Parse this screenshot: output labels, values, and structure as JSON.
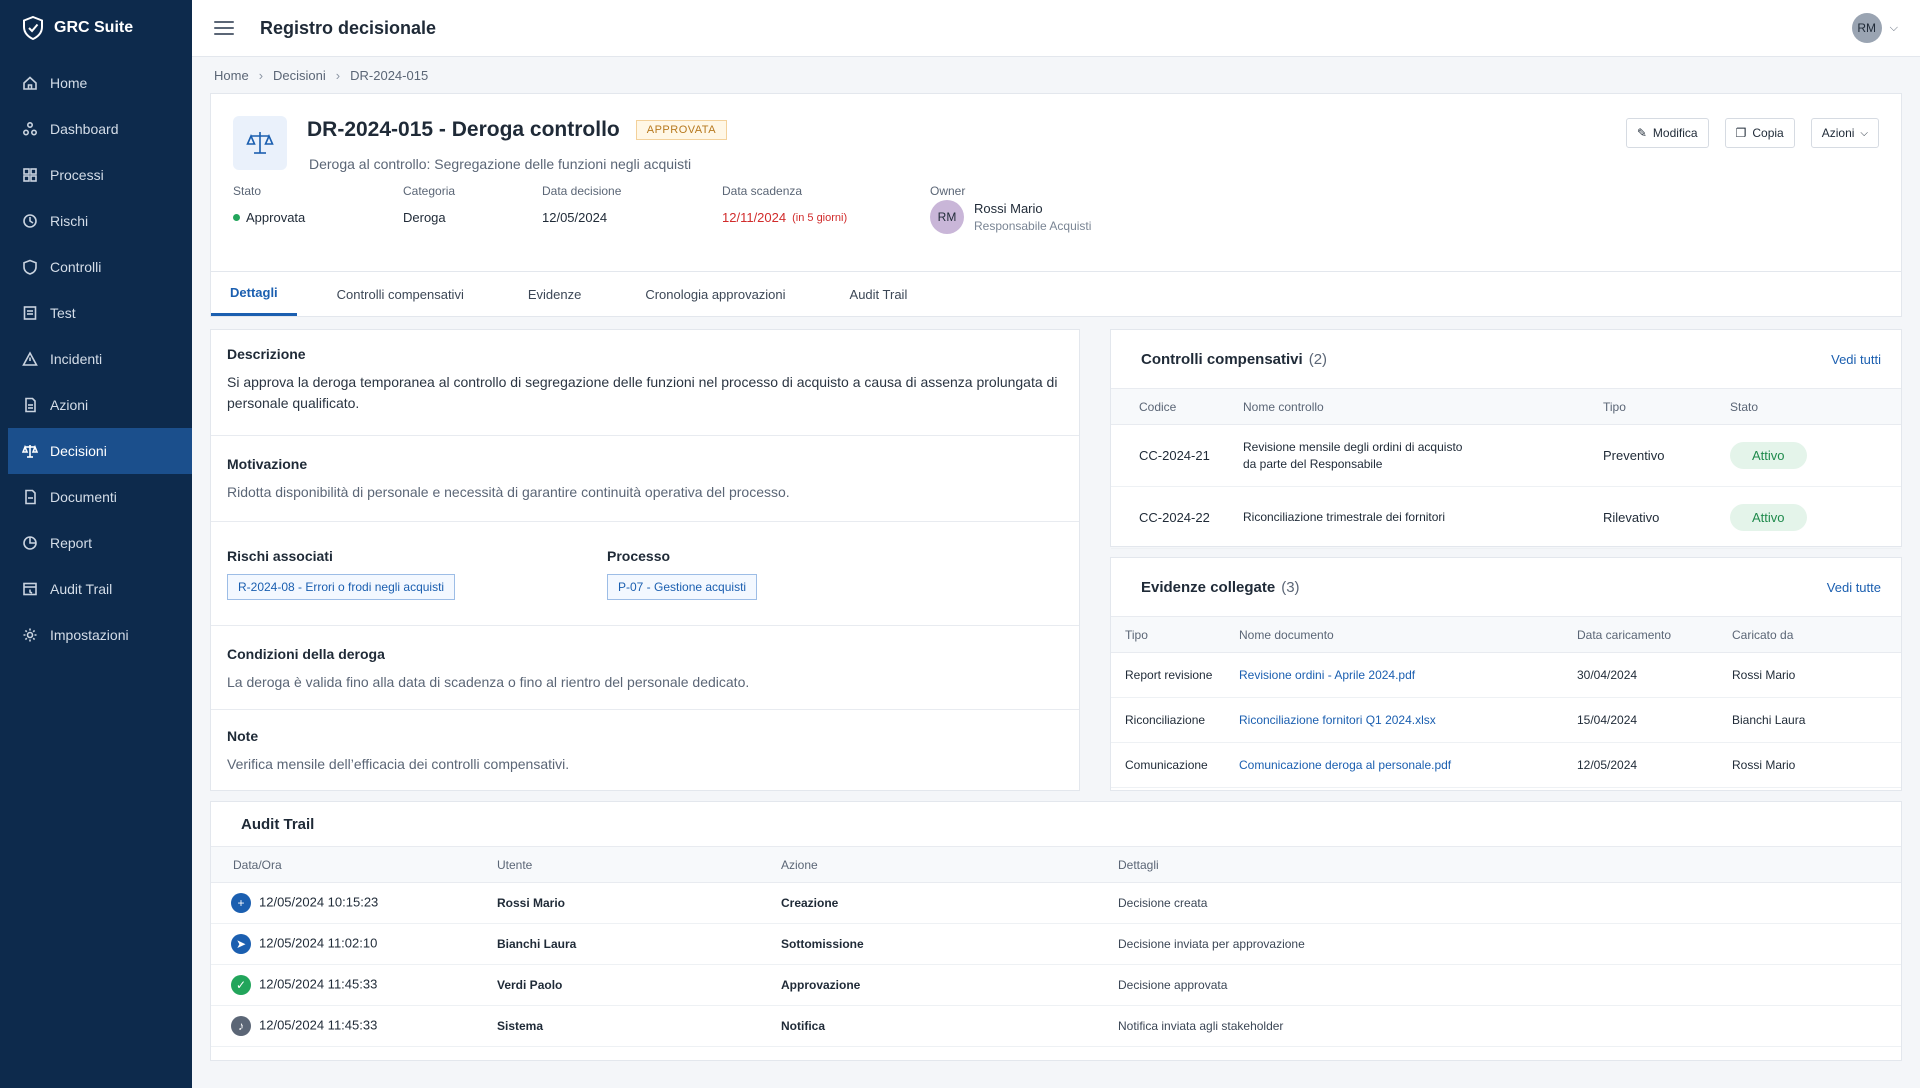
{
  "brand": {
    "name": "GRC Suite"
  },
  "sidebar": {
    "items": [
      {
        "label": "Home",
        "icon": "home-icon"
      },
      {
        "label": "Dashboard",
        "icon": "dashboard-icon"
      },
      {
        "label": "Processi",
        "icon": "process-icon"
      },
      {
        "label": "Rischi",
        "icon": "risk-icon"
      },
      {
        "label": "Controlli",
        "icon": "shield-icon"
      },
      {
        "label": "Test",
        "icon": "test-icon"
      },
      {
        "label": "Incidenti",
        "icon": "warning-icon"
      },
      {
        "label": "Azioni",
        "icon": "actions-icon"
      },
      {
        "label": "Decisioni",
        "icon": "scale-icon",
        "active": true
      },
      {
        "label": "Documenti",
        "icon": "document-icon"
      },
      {
        "label": "Report",
        "icon": "report-icon"
      },
      {
        "label": "Audit Trail",
        "icon": "audit-icon"
      },
      {
        "label": "Impostazioni",
        "icon": "gear-icon"
      }
    ]
  },
  "topbar": {
    "title": "Registro decisionale",
    "user_initials": "RM"
  },
  "breadcrumb": [
    "Home",
    "Decisioni",
    "DR-2024-015"
  ],
  "decision": {
    "title": "DR-2024-015 - Deroga controllo",
    "status_badge": "APPROVATA",
    "subtitle": "Deroga al controllo: Segregazione delle funzioni negli acquisti",
    "actions": {
      "edit": "Modifica",
      "copy": "Copia",
      "more": "Azioni"
    },
    "meta": {
      "stato_label": "Stato",
      "stato": "Approvata",
      "categoria_label": "Categoria",
      "categoria": "Deroga",
      "data_decisione_label": "Data decisione",
      "data_decisione": "12/05/2024",
      "data_scadenza_label": "Data scadenza",
      "data_scadenza": "12/11/2024",
      "scadenza_note": "(in 5 giorni)",
      "owner_label": "Owner",
      "owner_initials": "RM",
      "owner_name": "Rossi Mario",
      "owner_role": "Responsabile Acquisti"
    }
  },
  "tabs": [
    "Dettagli",
    "Controlli compensativi",
    "Evidenze",
    "Cronologia approvazioni",
    "Audit Trail"
  ],
  "details": {
    "descrizione_label": "Descrizione",
    "descrizione": "Si approva la deroga temporanea al controllo di segregazione delle funzioni nel processo di acquisto a causa di assenza prolungata di personale qualificato.",
    "motivazione_label": "Motivazione",
    "motivazione": "Ridotta disponibilità di personale e necessità di garantire continuità operativa del processo.",
    "rischi_label": "Rischi associati",
    "rischio": "R-2024-08 - Errori o frodi negli acquisti",
    "processo_label": "Processo",
    "processo": "P-07 - Gestione acquisti",
    "condizioni_label": "Condizioni della deroga",
    "condizioni": "La deroga è valida fino alla data di scadenza o fino al rientro del personale dedicato.",
    "note_label": "Note",
    "note": "Verifica mensile dell’efficacia dei controlli compensativi."
  },
  "controlli": {
    "title": "Controlli compensativi",
    "count": "(2)",
    "link": "Vedi tutti",
    "columns": [
      "Codice",
      "Nome controllo",
      "Tipo",
      "Stato"
    ],
    "rows": [
      {
        "codice": "CC-2024-21",
        "nome": "Revisione mensile degli ordini di acquisto da parte del Responsabile",
        "tipo": "Preventivo",
        "stato": "Attivo"
      },
      {
        "codice": "CC-2024-22",
        "nome": "Riconciliazione trimestrale dei fornitori",
        "tipo": "Rilevativo",
        "stato": "Attivo"
      }
    ]
  },
  "evidenze": {
    "title": "Evidenze collegate",
    "count": "(3)",
    "link": "Vedi tutte",
    "columns": [
      "Tipo",
      "Nome documento",
      "Data caricamento",
      "Caricato da"
    ],
    "rows": [
      {
        "tipo": "Report revisione",
        "nome": "Revisione ordini - Aprile 2024.pdf",
        "data": "30/04/2024",
        "utente": "Rossi Mario"
      },
      {
        "tipo": "Riconciliazione",
        "nome": "Riconciliazione fornitori Q1 2024.xlsx",
        "data": "15/04/2024",
        "utente": "Bianchi Laura"
      },
      {
        "tipo": "Comunicazione",
        "nome": "Comunicazione deroga al personale.pdf",
        "data": "12/05/2024",
        "utente": "Rossi Mario"
      }
    ]
  },
  "audit": {
    "title": "Audit Trail",
    "columns": [
      "Data/Ora",
      "Utente",
      "Azione",
      "Dettagli"
    ],
    "rows": [
      {
        "data": "12/05/2024  10:15:23",
        "utente": "Rossi Mario",
        "azione": "Creazione",
        "dettagli": "Decisione creata",
        "icon": "plus-icon",
        "color": "#1b5fb0",
        "glyph": "+"
      },
      {
        "data": "12/05/2024  11:02:10",
        "utente": "Bianchi Laura",
        "azione": "Sottomissione",
        "dettagli": "Decisione inviata per approvazione",
        "icon": "send-icon",
        "color": "#1b5fb0",
        "glyph": "➤"
      },
      {
        "data": "12/05/2024  11:45:33",
        "utente": "Verdi Paolo",
        "azione": "Approvazione",
        "dettagli": "Decisione approvata",
        "icon": "check-icon",
        "color": "#22a55b",
        "glyph": "✓"
      },
      {
        "data": "12/05/2024  11:45:33",
        "utente": "Sistema",
        "azione": "Notifica",
        "dettagli": "Notifica inviata agli stakeholder",
        "icon": "bell-icon",
        "color": "#5b6676",
        "glyph": "♪"
      }
    ]
  }
}
